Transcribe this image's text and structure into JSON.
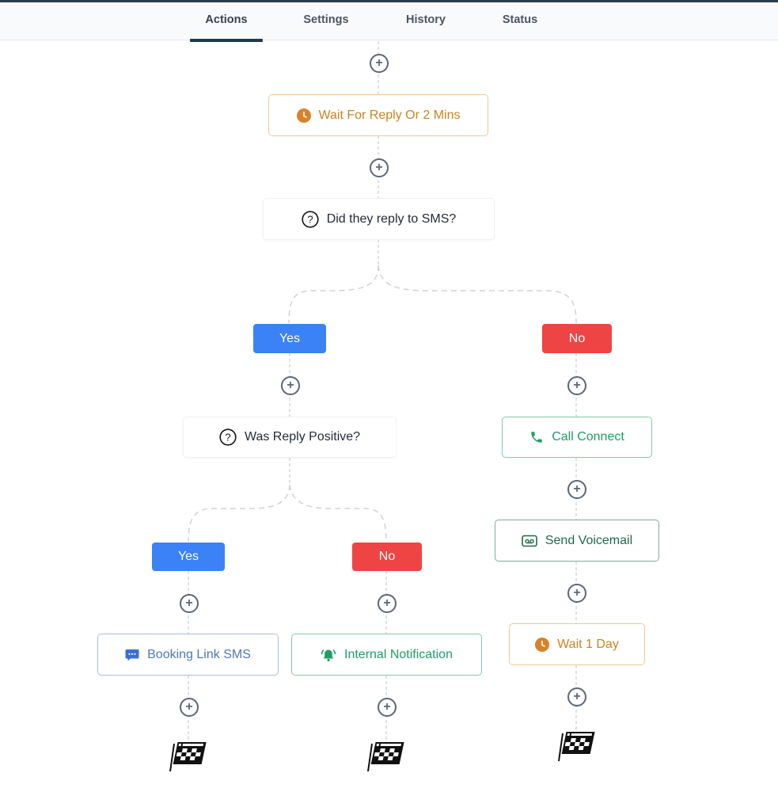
{
  "tabs": [
    {
      "label": "Actions",
      "active": true
    },
    {
      "label": "Settings",
      "active": false
    },
    {
      "label": "History",
      "active": false
    },
    {
      "label": "Status",
      "active": false
    }
  ],
  "workflow": {
    "wait_reply": {
      "label": "Wait For Reply Or 2 Mins",
      "icon": "clock-icon"
    },
    "condition_sms": {
      "label": "Did they reply to SMS?",
      "icon": "question-circle-icon"
    },
    "branch_sms_yes": {
      "label": "Yes"
    },
    "branch_sms_no": {
      "label": "No"
    },
    "condition_positive": {
      "label": "Was Reply Positive?",
      "icon": "question-circle-icon"
    },
    "branch_pos_yes": {
      "label": "Yes"
    },
    "branch_pos_no": {
      "label": "No"
    },
    "booking_sms": {
      "label": "Booking Link SMS",
      "icon": "chat-bubble-icon"
    },
    "internal_notification": {
      "label": "Internal Notification",
      "icon": "bell-icon"
    },
    "call_connect": {
      "label": "Call Connect",
      "icon": "phone-icon"
    },
    "send_voicemail": {
      "label": "Send Voicemail",
      "icon": "voicemail-icon"
    },
    "wait_day": {
      "label": "Wait 1 Day",
      "icon": "clock-icon"
    },
    "end_icon": "checkered-flag-icon",
    "add_icon": "plus-circle-icon"
  },
  "colors": {
    "yes": "#3b82f6",
    "no": "#ef4444",
    "wait": "#d9822b",
    "green": "#1f9d62",
    "blue": "#4f78b8",
    "tab_active": "#1e3a4f"
  }
}
